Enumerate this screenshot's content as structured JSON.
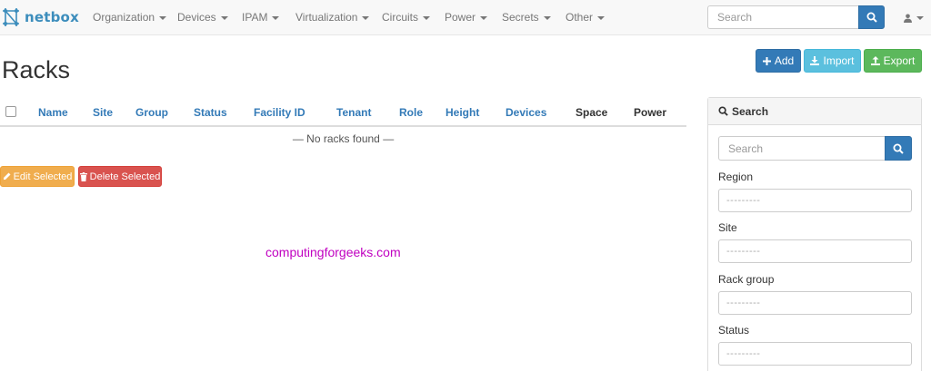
{
  "brand": {
    "name": "netbox"
  },
  "nav": {
    "items": [
      {
        "label": "Organization"
      },
      {
        "label": "Devices"
      },
      {
        "label": "IPAM"
      },
      {
        "label": "Virtualization"
      },
      {
        "label": "Circuits"
      },
      {
        "label": "Power"
      },
      {
        "label": "Secrets"
      },
      {
        "label": "Other"
      }
    ],
    "search_placeholder": "Search",
    "user_icon": "user-icon"
  },
  "page": {
    "title": "Racks"
  },
  "actions": {
    "add": "Add",
    "import": "Import",
    "export": "Export"
  },
  "table": {
    "columns": [
      {
        "label": "Name",
        "sortable": true
      },
      {
        "label": "Site",
        "sortable": true
      },
      {
        "label": "Group",
        "sortable": true
      },
      {
        "label": "Status",
        "sortable": true
      },
      {
        "label": "Facility ID",
        "sortable": true
      },
      {
        "label": "Tenant",
        "sortable": true
      },
      {
        "label": "Role",
        "sortable": true
      },
      {
        "label": "Height",
        "sortable": true
      },
      {
        "label": "Devices",
        "sortable": true
      },
      {
        "label": "Space",
        "sortable": false
      },
      {
        "label": "Power",
        "sortable": false
      }
    ],
    "empty_text": "— No racks found —",
    "edit_selected": "Edit Selected",
    "delete_selected": "Delete Selected"
  },
  "watermark": "computingforgeeks.com",
  "filter_panel": {
    "heading": "Search",
    "search_placeholder": "Search",
    "fields": [
      {
        "label": "Region",
        "value": "---------"
      },
      {
        "label": "Site",
        "value": "---------"
      },
      {
        "label": "Rack group",
        "value": "---------"
      },
      {
        "label": "Status",
        "value": "---------"
      }
    ]
  },
  "colors": {
    "primary": "#337ab7",
    "info": "#5bc0de",
    "success": "#5cb85c",
    "warning": "#f0ad4e",
    "danger": "#d9534f",
    "watermark": "#c000c0"
  }
}
